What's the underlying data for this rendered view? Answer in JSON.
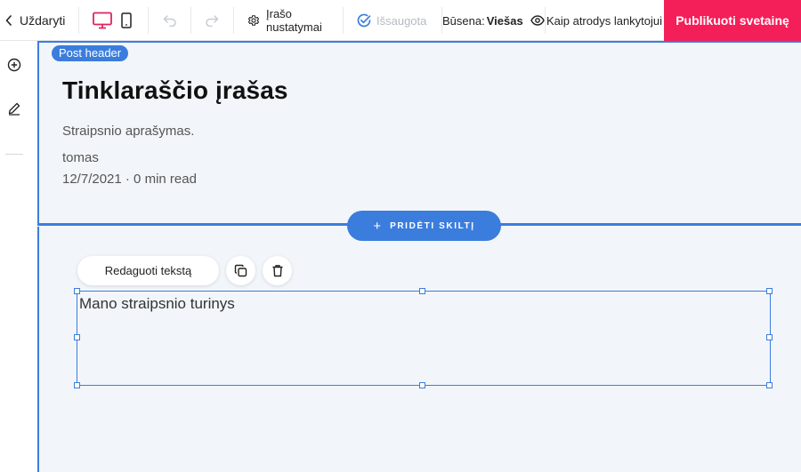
{
  "toolbar": {
    "close_label": "Uždaryti",
    "settings_label": "Įrašo nustatymai",
    "saved_label": "Išsaugota",
    "status_prefix": "Būsena:",
    "status_value": "Viešas",
    "preview_label": "Kaip atrodys lankytojui",
    "publish_label": "Publikuoti svetainę",
    "icons": [
      "chevron-left-icon",
      "desktop-icon",
      "mobile-icon",
      "undo-icon",
      "redo-icon",
      "gear-icon",
      "check-circle-icon",
      "eye-icon"
    ]
  },
  "rail": {
    "icons": [
      "plus-circle-icon",
      "pencil-icon"
    ]
  },
  "header_section": {
    "tag": "Post header",
    "title": "Tinklaraščio įrašas",
    "description": "Straipsnio aprašymas.",
    "author": "tomas",
    "meta": "12/7/2021 · 0 min read"
  },
  "add_section": {
    "label": "PRIDĖTI SKILTĮ"
  },
  "text_toolbar": {
    "edit_label": "Redaguoti tekstą",
    "icons": [
      "copy-icon",
      "trash-icon"
    ]
  },
  "text_block": {
    "content": "Mano straipsnio turinys"
  },
  "colors": {
    "accent": "#3b7ddd",
    "publish": "#f41e58",
    "desktop_active": "#e0245e",
    "canvas": "#f2f6fa"
  }
}
